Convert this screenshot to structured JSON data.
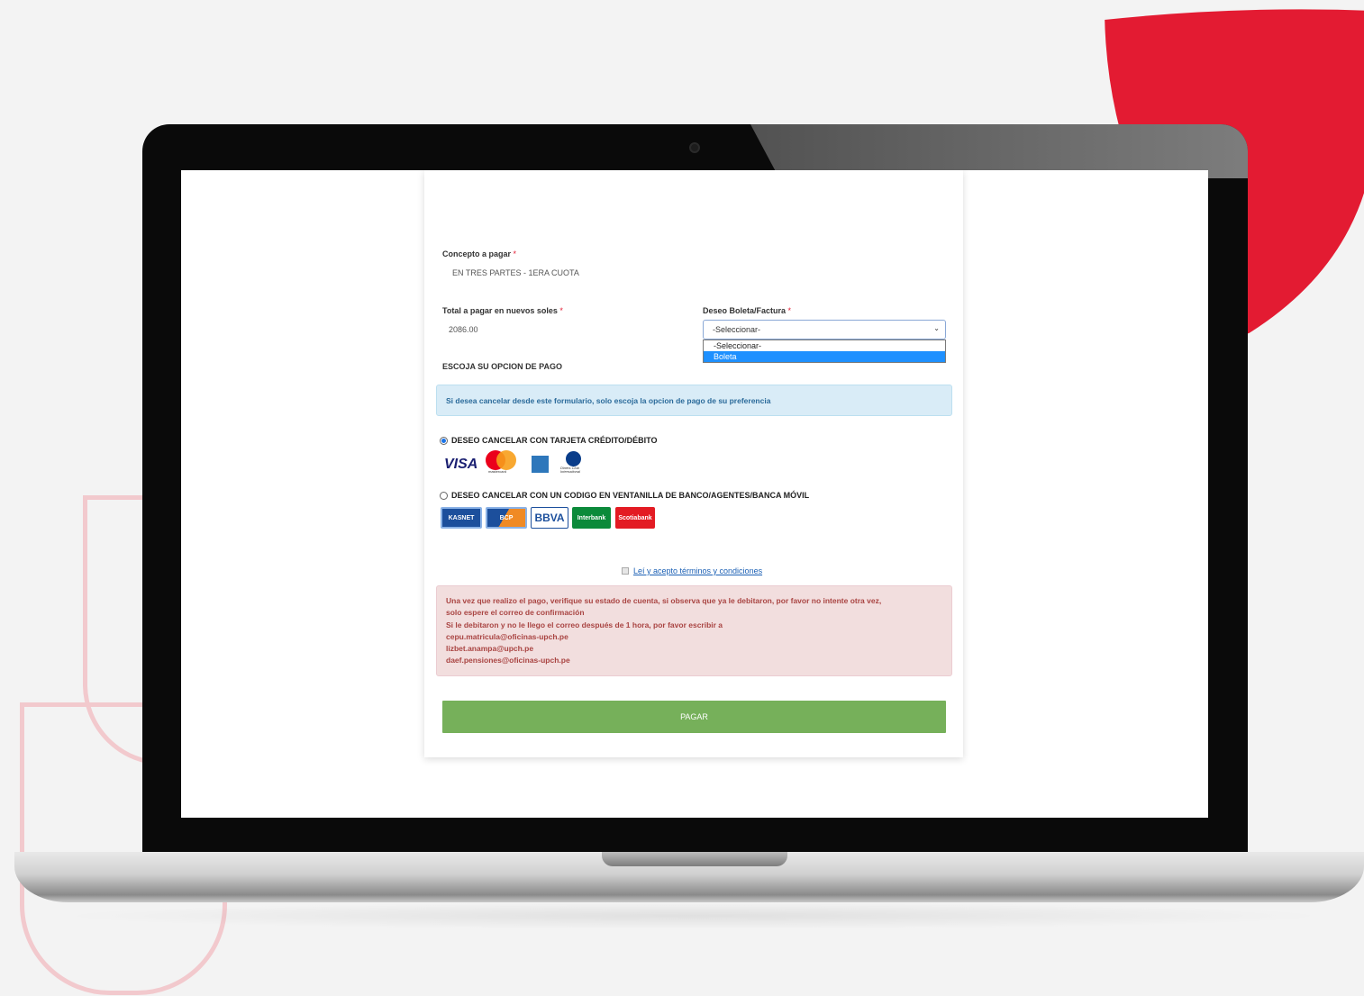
{
  "form": {
    "concept_label": "Concepto a pagar",
    "concept_value": "EN TRES PARTES - 1ERA CUOTA",
    "total_label": "Total a pagar en nuevos soles",
    "total_value": "2086.00",
    "invoice_label": "Deseo Boleta/Factura",
    "required_mark": "*",
    "invoice_select_value": "-Seleccionar-",
    "invoice_options": [
      "-Seleccionar-",
      "Boleta"
    ],
    "payment_heading": "ESCOJA SU OPCION DE PAGO",
    "info_text": "Si desea cancelar desde este formulario, solo escoja la opcion de pago de su preferencia",
    "option_card": "DESEO CANCELAR CON TARJETA CRÉDITO/DÉBITO",
    "option_code": "DESEO CANCELAR CON UN CODIGO EN VENTANILLA DE BANCO/AGENTES/BANCA MÓVIL",
    "card_logos": {
      "visa": "VISA",
      "mastercard": "mastercard",
      "diners": "Diners Club International"
    },
    "bank_logos": [
      "KASNET",
      "BCP",
      "BBVA",
      "Interbank",
      "Scotiabank"
    ],
    "terms_text": "Leí y acepto términos y condiciones",
    "alert_lines": [
      "Una vez que realizo el pago, verifique su estado de cuenta, si observa que ya le debitaron, por favor no intente otra vez,",
      "solo espere el correo de confirmación",
      "Si le debitaron y no le llego el correo después de 1 hora, por favor escribir a",
      "cepu.matricula@oficinas-upch.pe",
      "lizbet.anampa@upch.pe",
      "daef.pensiones@oficinas-upch.pe"
    ],
    "pay_button": "PAGAR"
  },
  "colors": {
    "brand_red": "#e31b32",
    "pay_green": "#76b05a",
    "info_bg": "#d9ecf7",
    "alert_bg": "#f2dede"
  }
}
